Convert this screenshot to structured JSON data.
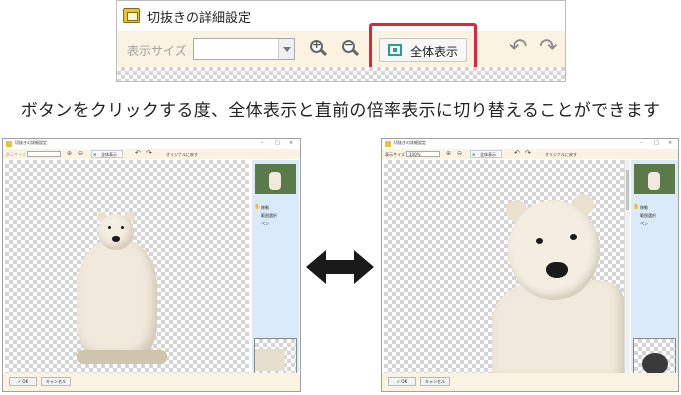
{
  "crop": {
    "window_title": "切抜きの詳細設定",
    "zoom_label": "表示サイズ",
    "zoom_value": "",
    "fit_button_label": "全体表示",
    "icons": [
      "app-icon",
      "zoom-in-icon",
      "zoom-out-icon",
      "fit-icon",
      "undo-icon",
      "redo-icon"
    ]
  },
  "caption": "ボタンをクリックする度、全体表示と直前の倍率表示に切り替えることができます",
  "left_window": {
    "title": "切抜きの詳細設定",
    "zoom_label": "表示サイズ",
    "fit_label": "全体表示",
    "original_label": "オリジナルに戻す",
    "tools": [
      "移動",
      "範囲選択",
      "ペン"
    ],
    "ok_label": "OK",
    "cancel_label": "キャンセル"
  },
  "right_window": {
    "title": "切抜きの詳細設定",
    "zoom_label": "表示サイズ",
    "zoom_value": "100%",
    "fit_label": "全体表示",
    "original_label": "オリジナルに戻す",
    "tools": [
      "移動",
      "範囲選択",
      "ペン"
    ],
    "ok_label": "OK",
    "cancel_label": "キャンセル"
  },
  "colors": {
    "highlight": "#d9283b",
    "toolbar_bg": "#faf3e1",
    "side_panel": "#dbeaf8",
    "fit_icon": "#2a9d8f"
  }
}
